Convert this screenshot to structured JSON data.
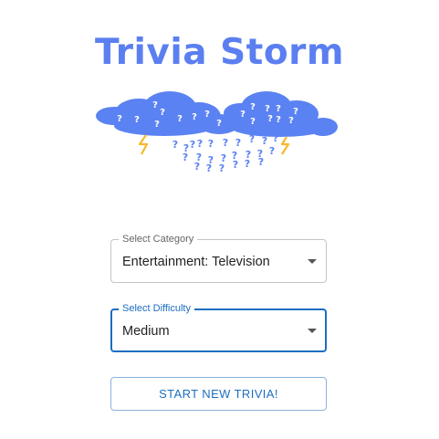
{
  "app": {
    "title": "Trivia Storm"
  },
  "logo": {
    "icon": "storm-cloud-question-marks",
    "question_glyph": "?"
  },
  "form": {
    "category": {
      "label": "Select Category",
      "value": "Entertainment: Television"
    },
    "difficulty": {
      "label": "Select Difficulty",
      "value": "Medium",
      "focused": true
    },
    "start_button": "START NEW TRIVIA!"
  },
  "colors": {
    "brand": "#5b7ff0",
    "cloud": "#5b82f2",
    "lightning": "#f5b82e",
    "primary": "#1c6ec0",
    "outline_button_border": "#8ab3dd"
  }
}
